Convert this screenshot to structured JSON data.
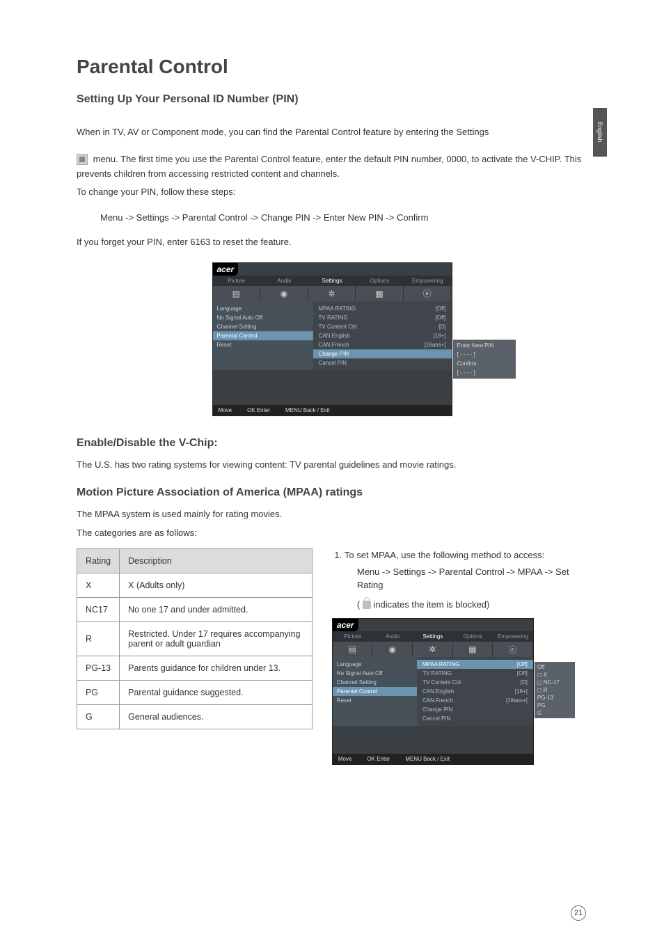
{
  "side_tab": "English",
  "title": "Parental Control",
  "s1": {
    "heading": "Setting Up Your Personal ID Number (PIN)",
    "intro": "When in TV, AV or Component mode, you can find the Parental Control feature by entering the Settings",
    "icon_line": " menu. The first time you use the Parental Control feature, enter the default  PIN number, 0000, to activate the V-CHIP. This prevents children from accessing restricted content and channels.",
    "change_pin": "To change your PIN, follow these steps:",
    "nav_path": "Menu -> Settings -> Parental Control -> Change PIN -> Enter New PIN -> Confirm",
    "forget": "If you forget your PIN, enter 6163 to reset the feature."
  },
  "osd1": {
    "brand": "acer",
    "tabs": [
      "Picture",
      "Audio",
      "Settings",
      "Options",
      "Empowering"
    ],
    "left": [
      "Language",
      "No Signal Auto Off",
      "Channel Setting",
      "Parental Control",
      "Reset"
    ],
    "right": [
      {
        "l": "MPAA RATING",
        "v": "[Off]"
      },
      {
        "l": "TV RATING",
        "v": "[Off]"
      },
      {
        "l": "TV Content Ctrl.",
        "v": "[D]"
      },
      {
        "l": "CAN.English",
        "v": "[18+]"
      },
      {
        "l": "CAN.French",
        "v": "[18ans+]"
      },
      {
        "l": "Change PIN",
        "v": ""
      },
      {
        "l": "Cancel PIN",
        "v": ""
      }
    ],
    "popup": [
      "Enter New PIN",
      "[ -  -  -  - ]",
      "Confirm",
      "[ -  -  -  - ]"
    ],
    "footer": [
      "Move",
      "OK  Enter",
      "MENU  Back / Exit"
    ]
  },
  "s2": {
    "heading": "Enable/Disable the V-Chip:",
    "line": "The U.S. has two rating systems for viewing content: TV parental guidelines and movie ratings."
  },
  "s3": {
    "heading": "Motion Picture Association of America (MPAA) ratings",
    "l1": "The MPAA system is used mainly for rating movies.",
    "l2": "The categories are as follows:"
  },
  "table": {
    "h1": "Rating",
    "h2": "Description",
    "rows": [
      {
        "r": "X",
        "d": "X (Adults only)"
      },
      {
        "r": "NC17",
        "d": "No one 17 and under admitted."
      },
      {
        "r": "R",
        "d": "Restricted. Under 17 requires accompanying parent or adult guardian"
      },
      {
        "r": "PG-13",
        "d": "Parents guidance for children under 13."
      },
      {
        "r": "PG",
        "d": "Parental guidance suggested."
      },
      {
        "r": "G",
        "d": "General audiences."
      }
    ]
  },
  "rightcol": {
    "step1": "To set MPAA, use the following method to access:",
    "nav": "Menu -> Settings -> Parental Control -> MPAA -> Set Rating",
    "hint_pre": "( ",
    "hint_post": " indicates the item is blocked)"
  },
  "osd2": {
    "brand": "acer",
    "tabs": [
      "Picture",
      "Audio",
      "Settings",
      "Options",
      "Empowering"
    ],
    "left": [
      "Language",
      "No Signal Auto Off",
      "Channel Setting",
      "Parental Control",
      "Reset"
    ],
    "right": [
      {
        "l": "MPAA RATING",
        "v": "[Off]"
      },
      {
        "l": "TV RATING",
        "v": "[Off]"
      },
      {
        "l": "TV Content Ctrl.",
        "v": "[D]"
      },
      {
        "l": "CAN.English",
        "v": "[18+]"
      },
      {
        "l": "CAN.French",
        "v": "[18ans+]"
      },
      {
        "l": "Change PIN",
        "v": ""
      },
      {
        "l": "Cancel PIN",
        "v": ""
      }
    ],
    "popup": [
      "Off",
      "◻ X",
      "◻ NC-17",
      "◻ R",
      "  PG-13",
      "  PG",
      "  G"
    ],
    "footer": [
      "Move",
      "OK  Enter",
      "MENU  Back / Exit"
    ]
  },
  "page": "21"
}
